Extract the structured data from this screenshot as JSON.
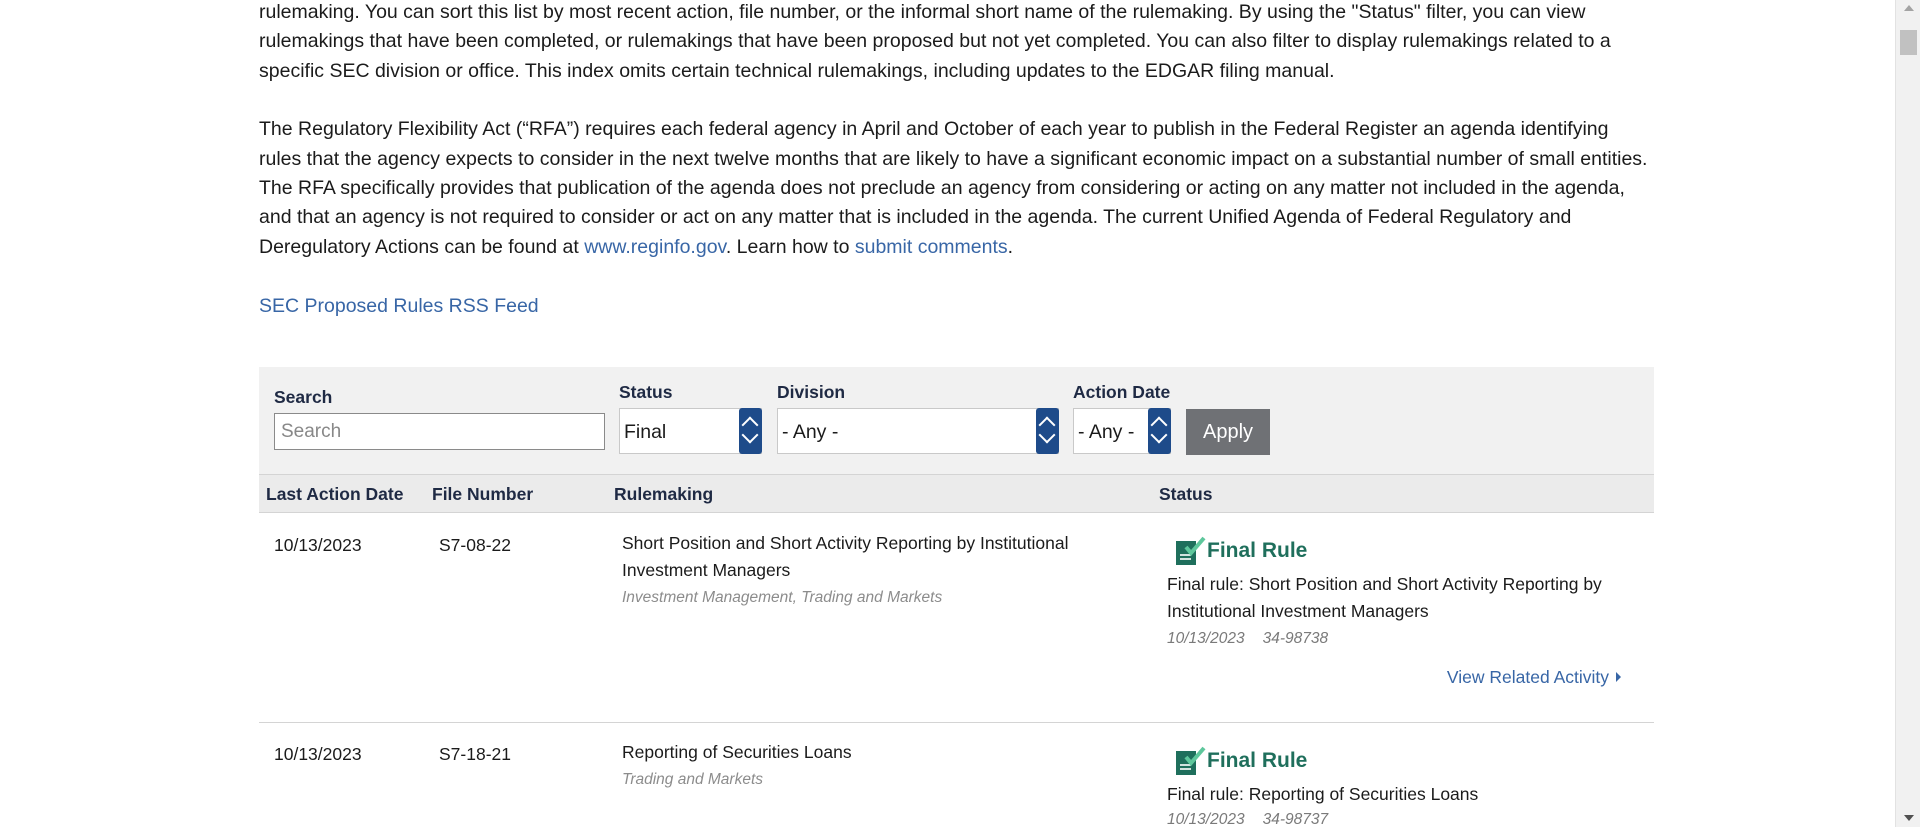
{
  "intro": {
    "para1": "rulemaking. You can sort this list by most recent action, file number, or the informal short name of the rulemaking. By using the \"Status\" filter, you can view rulemakings that have been completed, or rulemakings that have been proposed but not yet completed. You can also filter to display rulemakings related to a specific SEC division or office. This index omits certain technical rulemakings, including updates to the EDGAR filing manual.",
    "para2_before": "The Regulatory Flexibility Act (“RFA”) requires each federal agency in April and October of each year to publish in the Federal Register an agenda identifying rules that the agency expects to consider in the next twelve months that are likely to have a significant economic impact on a substantial number of small entities. The RFA specifically provides that publication of the agenda does not preclude an agency from considering or acting on any matter not included in the agenda, and that an agency is not required to consider or act on any matter that is included in the agenda. The current Unified Agenda of Federal Regulatory and Deregulatory Actions can be found at ",
    "reginfo_link": "www.reginfo.gov",
    "para2_middle": ". Learn how to ",
    "submit_link": "submit comments",
    "para2_end": ".",
    "rss_link": "SEC Proposed Rules RSS Feed"
  },
  "filters": {
    "search_label": "Search",
    "search_placeholder": "Search",
    "status_label": "Status",
    "status_value": "Final",
    "division_label": "Division",
    "division_value": "- Any -",
    "action_date_label": "Action Date",
    "action_date_value": "- Any -",
    "apply_label": "Apply"
  },
  "table": {
    "headers": [
      "Last Action Date",
      "File Number",
      "Rulemaking",
      "Status"
    ],
    "rows": [
      {
        "date": "10/13/2023",
        "file_number": "S7-08-22",
        "title": "Short Position and Short Activity Reporting by Institutional Investment Managers",
        "divisions": "Investment Management, Trading and Markets",
        "status_label": "Final Rule",
        "status_desc": "Final rule: Short Position and Short Activity Reporting by Institutional Investment Managers",
        "status_date": "10/13/2023",
        "release_no": "34-98738",
        "related_link": "View Related Activity"
      },
      {
        "date": "10/13/2023",
        "file_number": "S7-18-21",
        "title": "Reporting of Securities Loans",
        "divisions": "Trading and Markets",
        "status_label": "Final Rule",
        "status_desc": "Final rule: Reporting of Securities Loans",
        "status_date": "10/13/2023",
        "release_no": "34-98737"
      }
    ]
  },
  "icons": {
    "status_icon": "final-rule-check-document-icon",
    "select_arrows": "up-down-chevron-icon",
    "related_caret": "caret-right-icon"
  },
  "colors": {
    "link": "#3866a6",
    "status_green": "#1f6f5c",
    "select_arrow_bg": "#1e4b8a",
    "apply_bg": "#6f7175"
  }
}
